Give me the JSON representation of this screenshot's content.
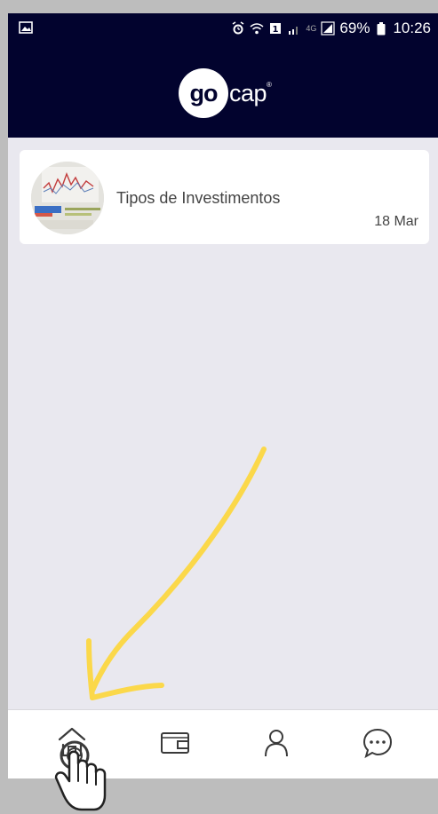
{
  "status_bar": {
    "battery_percent": "69%",
    "time": "10:26",
    "network_label": "4G"
  },
  "header": {
    "logo_bold": "go",
    "logo_rest": "cap",
    "logo_mark": "®"
  },
  "feed": {
    "items": [
      {
        "title": "Tipos de Investimentos",
        "date": "18 Mar",
        "thumbnail_icon": "stock-chart-thumbnail"
      }
    ]
  },
  "tabbar": {
    "items": [
      {
        "name": "home",
        "icon": "home-icon",
        "active": true
      },
      {
        "name": "wallet",
        "icon": "wallet-icon",
        "active": false
      },
      {
        "name": "profile",
        "icon": "user-icon",
        "active": false
      },
      {
        "name": "chat",
        "icon": "chat-icon",
        "active": false
      }
    ]
  },
  "annotation": {
    "arrow_color": "#fbd84a",
    "cursor_icon": "hand-pointer-icon"
  },
  "colors": {
    "header_bg": "#02032e",
    "screen_bg": "#e9e8ef",
    "frame_bg": "#bdbdbd"
  }
}
